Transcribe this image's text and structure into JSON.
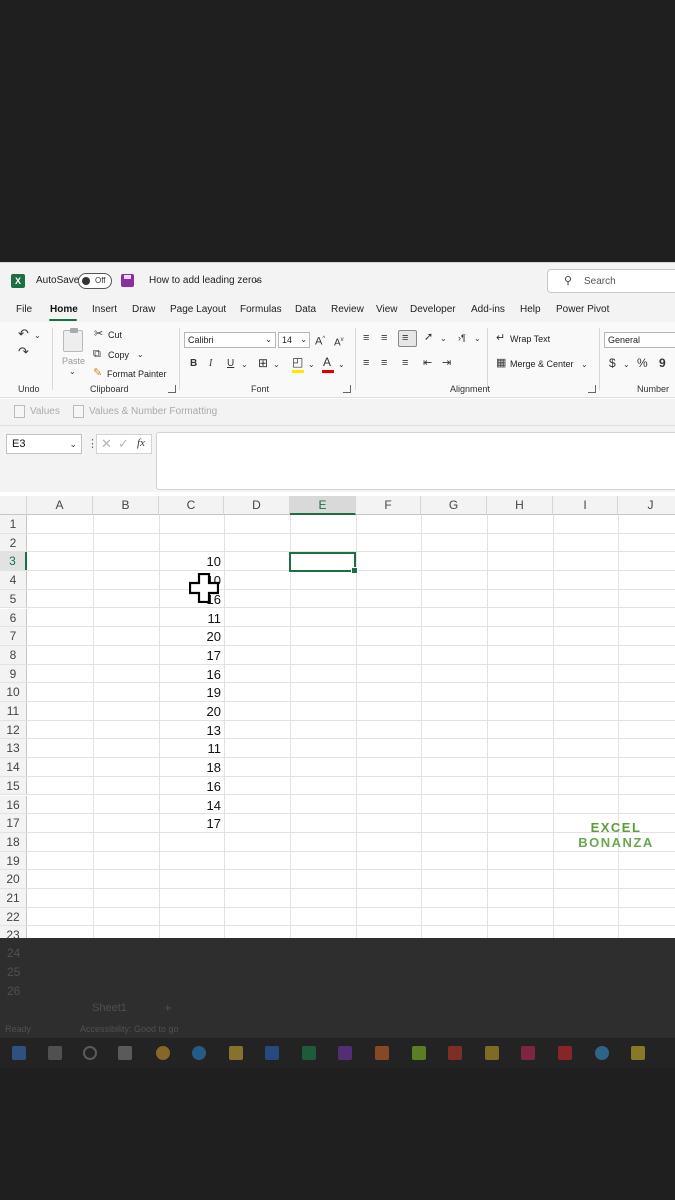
{
  "titlebar": {
    "app_icon": "X",
    "autosave_label": "AutoSave",
    "autosave_state": "Off",
    "doc_title": "How to add leading zeros",
    "search_placeholder": "Search"
  },
  "tabs": [
    "File",
    "Home",
    "Insert",
    "Draw",
    "Page Layout",
    "Formulas",
    "Data",
    "Review",
    "View",
    "Developer",
    "Add-ins",
    "Help",
    "Power Pivot"
  ],
  "active_tab": "Home",
  "ribbon": {
    "undo_group": "Undo",
    "paste_label": "Paste",
    "cut_label": "Cut",
    "copy_label": "Copy",
    "format_painter_label": "Format Painter",
    "clipboard_group": "Clipboard",
    "font_name": "Calibri",
    "font_size": "14",
    "bold": "B",
    "italic": "I",
    "underline": "U",
    "font_group": "Font",
    "wrap_text": "Wrap Text",
    "merge_center": "Merge & Center",
    "alignment_group": "Alignment",
    "number_format": "General",
    "currency": "$",
    "percent": "%",
    "comma": "9",
    "number_group": "Number"
  },
  "suggestions": {
    "values": "Values",
    "values_number_formatting": "Values & Number Formatting"
  },
  "formula_bar": {
    "name_box": "E3",
    "fx": "fx",
    "formula": ""
  },
  "columns": [
    "A",
    "B",
    "C",
    "D",
    "E",
    "F",
    "G",
    "H",
    "I",
    "J"
  ],
  "selected_column": "E",
  "selected_row": "3",
  "rows": [
    {
      "num": "1",
      "c": ""
    },
    {
      "num": "2",
      "c": ""
    },
    {
      "num": "3",
      "c": "10"
    },
    {
      "num": "4",
      "c": "10"
    },
    {
      "num": "5",
      "c": "16"
    },
    {
      "num": "6",
      "c": "11"
    },
    {
      "num": "7",
      "c": "20"
    },
    {
      "num": "8",
      "c": "17"
    },
    {
      "num": "9",
      "c": "16"
    },
    {
      "num": "10",
      "c": "19"
    },
    {
      "num": "11",
      "c": "20"
    },
    {
      "num": "12",
      "c": "13"
    },
    {
      "num": "13",
      "c": "11"
    },
    {
      "num": "14",
      "c": "18"
    },
    {
      "num": "15",
      "c": "16"
    },
    {
      "num": "16",
      "c": "14"
    },
    {
      "num": "17",
      "c": "17"
    },
    {
      "num": "18",
      "c": ""
    },
    {
      "num": "19",
      "c": ""
    },
    {
      "num": "20",
      "c": ""
    },
    {
      "num": "21",
      "c": ""
    },
    {
      "num": "22",
      "c": ""
    },
    {
      "num": "23",
      "c": ""
    }
  ],
  "dimmed": {
    "rows": [
      "24",
      "25",
      "26"
    ],
    "sheet_tab": "Sheet1",
    "status_ready": "Ready",
    "accessibility": "Accessibility: Good to go"
  },
  "watermark": {
    "line1": "EXCEL",
    "line2": "BONANZA"
  },
  "colors": {
    "excel_green": "#1d6f42",
    "background": "#1f1f1f",
    "logo_green": "#5d9c3c"
  }
}
